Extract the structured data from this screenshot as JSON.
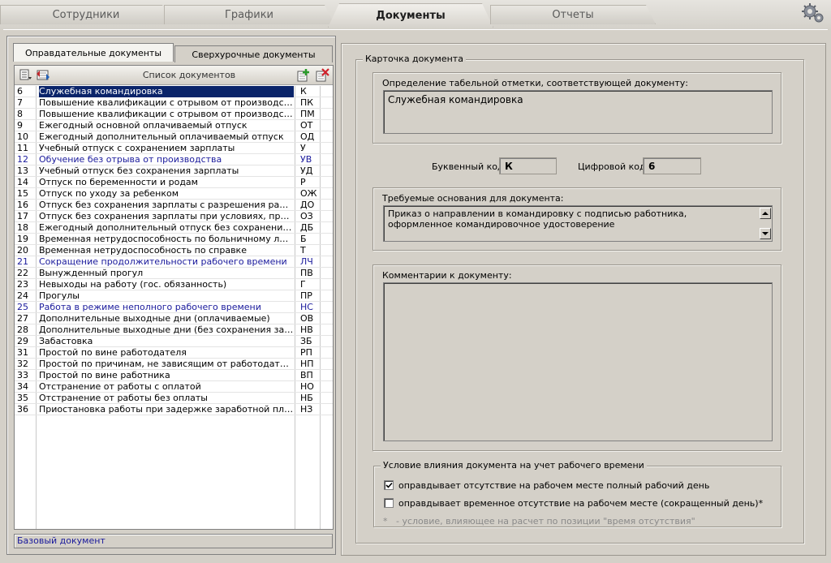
{
  "top_tabs": [
    "Сотрудники",
    "Графики",
    "Документы",
    "Отчеты"
  ],
  "active_top_tab": "Документы",
  "left": {
    "tabs": [
      "Оправдательные документы",
      "Сверхурочные документы"
    ],
    "active_tab": "Оправдательные документы",
    "list_caption": "Список документов",
    "rows": [
      {
        "id": "6",
        "name": "Служебная командировка",
        "code": "К",
        "blue": false,
        "selected": true
      },
      {
        "id": "7",
        "name": "Повышение квалификации с отрывом от производства",
        "code": "ПК",
        "blue": false
      },
      {
        "id": "8",
        "name": "Повышение квалификации с отрывом от производства в ...",
        "code": "ПМ",
        "blue": false
      },
      {
        "id": "9",
        "name": "Ежегодный основной оплачиваемый отпуск",
        "code": "ОТ",
        "blue": false
      },
      {
        "id": "10",
        "name": "Ежегодный дополнительный оплачиваемый отпуск",
        "code": "ОД",
        "blue": false
      },
      {
        "id": "11",
        "name": "Учебный отпуск с сохранением зарплаты",
        "code": "У",
        "blue": false
      },
      {
        "id": "12",
        "name": "Обучение без отрыва от производства",
        "code": "УВ",
        "blue": true
      },
      {
        "id": "13",
        "name": "Учебный отпуск без сохранения зарплаты",
        "code": "УД",
        "blue": false
      },
      {
        "id": "14",
        "name": "Отпуск по беременности и родам",
        "code": "Р",
        "blue": false
      },
      {
        "id": "15",
        "name": "Отпуск по уходу за ребенком",
        "code": "ОЖ",
        "blue": false
      },
      {
        "id": "16",
        "name": "Отпуск без сохранения зарплаты с разрешения работода...",
        "code": "ДО",
        "blue": false
      },
      {
        "id": "17",
        "name": "Отпуск без сохранения зарплаты при условиях, предусм...",
        "code": "ОЗ",
        "blue": false
      },
      {
        "id": "18",
        "name": "Ежегодный дополнительный отпуск без сохранения зарп...",
        "code": "ДБ",
        "blue": false
      },
      {
        "id": "19",
        "name": "Временная нетрудоспособность по больничному листу",
        "code": "Б",
        "blue": false
      },
      {
        "id": "20",
        "name": "Временная нетрудоспособность по справке",
        "code": "Т",
        "blue": false
      },
      {
        "id": "21",
        "name": "Сокращение продолжительности рабочего времени",
        "code": "ЛЧ",
        "blue": true
      },
      {
        "id": "22",
        "name": "Вынужденный прогул",
        "code": "ПВ",
        "blue": false
      },
      {
        "id": "23",
        "name": "Невыходы на работу (гос. обязанность)",
        "code": "Г",
        "blue": false
      },
      {
        "id": "24",
        "name": "Прогулы",
        "code": "ПР",
        "blue": false
      },
      {
        "id": "25",
        "name": "Работа в режиме неполного рабочего времени",
        "code": "НС",
        "blue": true
      },
      {
        "id": "27",
        "name": "Дополнительные выходные дни (оплачиваемые)",
        "code": "ОВ",
        "blue": false
      },
      {
        "id": "28",
        "name": "Дополнительные выходные дни (без сохранения зарпла...",
        "code": "НВ",
        "blue": false
      },
      {
        "id": "29",
        "name": "Забастовка",
        "code": "ЗБ",
        "blue": false
      },
      {
        "id": "31",
        "name": "Простой по вине работодателя",
        "code": "РП",
        "blue": false
      },
      {
        "id": "32",
        "name": "Простой по причинам, не зависящим от работодателя и р...",
        "code": "НП",
        "blue": false
      },
      {
        "id": "33",
        "name": "Простой по вине работника",
        "code": "ВП",
        "blue": false
      },
      {
        "id": "34",
        "name": "Отстранение от работы с оплатой",
        "code": "НО",
        "blue": false
      },
      {
        "id": "35",
        "name": "Отстранение от работы без оплаты",
        "code": "НБ",
        "blue": false
      },
      {
        "id": "36",
        "name": "Приостановка работы при задержке заработной платы",
        "code": "НЗ",
        "blue": false
      }
    ],
    "base_doc": "Базовый документ"
  },
  "card": {
    "title": "Карточка документа",
    "definition_label": "Определение табельной отметки, соответствующей документу:",
    "definition_value": "Служебная командировка",
    "letter_code_label": "Буквенный код",
    "letter_code": "К",
    "digit_code_label": "Цифровой код",
    "digit_code": "6",
    "grounds_label": "Требуемые основания для документа:",
    "grounds_value": "Приказ о направлении в командировку с подписью работника, оформленное командировочное удостоверение",
    "comments_label": "Комментарии к документу:",
    "comments_value": "",
    "condition_title": "Условие влияния документа на учет рабочего времени",
    "condition_full": "оправдывает отсутствие на рабочем месте полный рабочий день",
    "condition_full_checked": true,
    "condition_partial": "оправдывает временное отсутствие на рабочем месте (сокращенный день)*",
    "condition_partial_checked": false,
    "footnote": "*   - условие, влияющее на расчет по позиции \"время отсутствия\""
  }
}
